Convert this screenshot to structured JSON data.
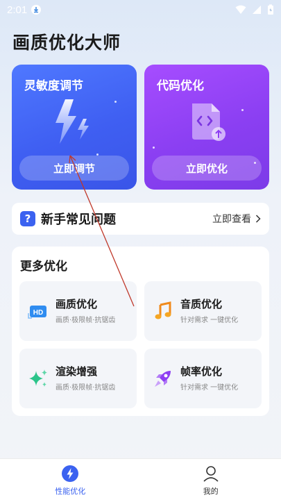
{
  "status_bar": {
    "time": "2:01"
  },
  "app": {
    "title": "画质优化大师"
  },
  "cards": [
    {
      "title": "灵敏度调节",
      "button": "立即调节"
    },
    {
      "title": "代码优化",
      "button": "立即优化"
    }
  ],
  "faq": {
    "title": "新手常见问题",
    "link": "立即查看"
  },
  "more": {
    "title": "更多优化",
    "items": [
      {
        "title": "画质优化",
        "subtitle": "画质·极限帧·抗锯齿"
      },
      {
        "title": "音质优化",
        "subtitle": "针对需求 一键优化"
      },
      {
        "title": "渲染增强",
        "subtitle": "画质·极限帧·抗锯齿"
      },
      {
        "title": "帧率优化",
        "subtitle": "针对需求 一键优化"
      }
    ]
  },
  "tabs": [
    {
      "label": "性能优化",
      "active": true
    },
    {
      "label": "我的",
      "active": false
    }
  ],
  "colors": {
    "accent": "#3b62f0",
    "sens_card": "#4568f5",
    "code_card": "#8e3ff2"
  }
}
